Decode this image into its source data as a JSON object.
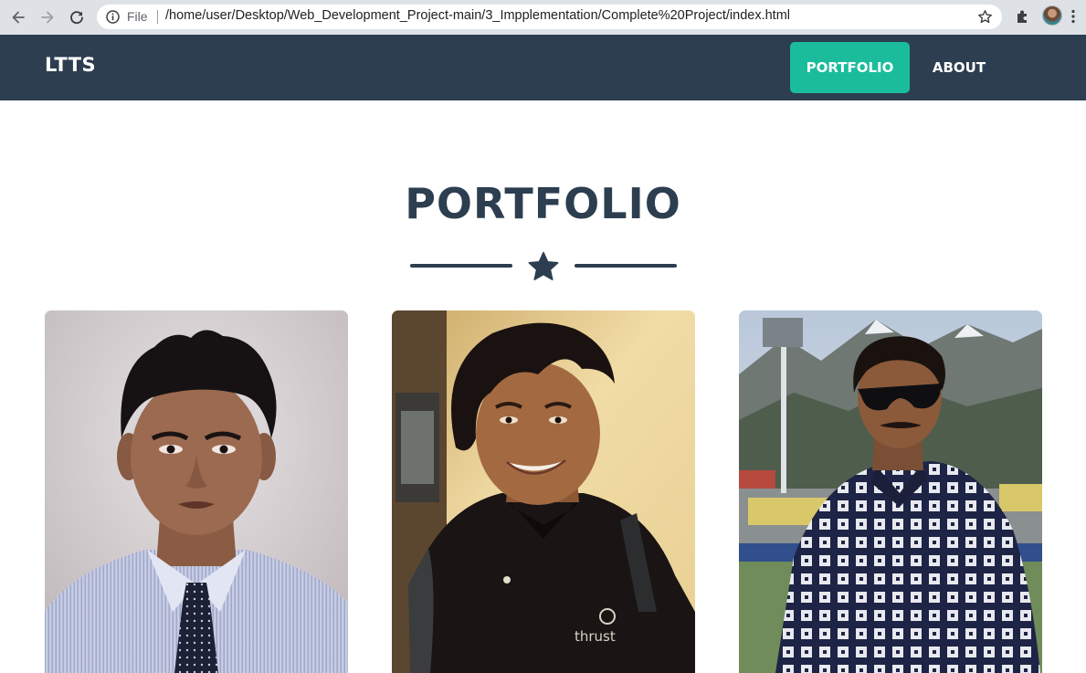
{
  "browser": {
    "file_label": "File",
    "url": "/home/user/Desktop/Web_Development_Project-main/3_Impplementation/Complete%20Project/index.html",
    "icons": [
      "back-arrow-icon",
      "forward-arrow-icon",
      "reload-icon",
      "info-icon",
      "bookmark-star-icon",
      "extensions-puzzle-icon",
      "profile-avatar",
      "kebab-menu-icon"
    ]
  },
  "navbar": {
    "brand": "LTTS",
    "links": [
      {
        "label": "PORTFOLIO",
        "active": true
      },
      {
        "label": "ABOUT",
        "active": false
      }
    ],
    "background_color": "#2c3e50",
    "active_color": "#1abc9c"
  },
  "portfolio": {
    "heading": "PORTFOLIO",
    "divider_icon": "star-icon",
    "items": [
      {
        "subject": "portrait-formal-shirt-tie"
      },
      {
        "subject": "portrait-black-polo-backpack"
      },
      {
        "subject": "portrait-plaid-shirt-stadium"
      }
    ]
  }
}
